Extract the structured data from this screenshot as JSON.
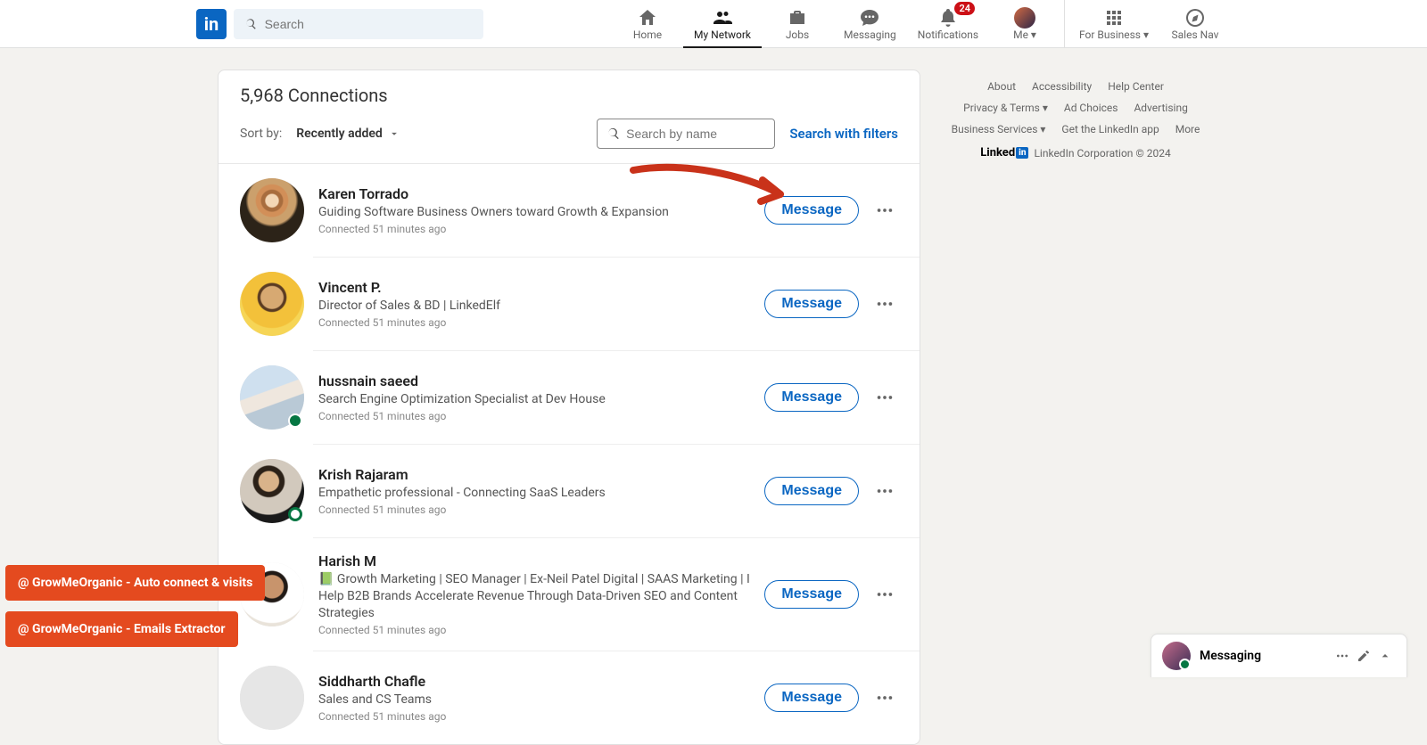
{
  "search": {
    "placeholder": "Search"
  },
  "nav": {
    "home": "Home",
    "network": "My Network",
    "jobs": "Jobs",
    "messaging": "Messaging",
    "notifications": "Notifications",
    "notif_count": "24",
    "me": "Me",
    "business": "For Business",
    "salesnav": "Sales Nav"
  },
  "page": {
    "title": "5,968 Connections",
    "sort_label": "Sort by:",
    "sort_value": "Recently added",
    "name_search_placeholder": "Search by name",
    "filters_link": "Search with filters",
    "message_btn": "Message"
  },
  "connections": [
    {
      "name": "Karen Torrado",
      "headline": "Guiding Software Business Owners toward Growth & Expansion",
      "time": "Connected 51 minutes ago",
      "avatar": "av1",
      "presence": ""
    },
    {
      "name": "Vincent P.",
      "headline": "Director of Sales & BD | LinkedElf",
      "time": "Connected 51 minutes ago",
      "avatar": "av2",
      "presence": ""
    },
    {
      "name": "hussnain saeed",
      "headline": "Search Engine Optimization Specialist at Dev House",
      "time": "Connected 51 minutes ago",
      "avatar": "av3",
      "presence": "green"
    },
    {
      "name": "Krish Rajaram",
      "headline": "Empathetic professional - Connecting SaaS Leaders",
      "time": "Connected 51 minutes ago",
      "avatar": "av4",
      "presence": "ring"
    },
    {
      "name": "Harish M",
      "headline": "📗 Growth Marketing | SEO Manager | Ex-Neil Patel Digital | SAAS Marketing | I Help B2B Brands Accelerate Revenue Through Data-Driven SEO and Content Strategies",
      "time": "Connected 51 minutes ago",
      "avatar": "av5",
      "presence": ""
    },
    {
      "name": "Siddharth Chafle",
      "headline": "Sales and CS Teams",
      "time": "Connected 51 minutes ago",
      "avatar": "av6",
      "presence": ""
    }
  ],
  "footer": {
    "links": [
      "About",
      "Accessibility",
      "Help Center",
      "Privacy & Terms ▾",
      "Ad Choices",
      "Advertising",
      "Business Services ▾",
      "Get the LinkedIn app",
      "More"
    ],
    "copy": "LinkedIn Corporation © 2024"
  },
  "ext": {
    "pill1": "@ GrowMeOrganic - Auto connect & visits",
    "pill2": "@ GrowMeOrganic - Emails Extractor"
  },
  "msgbar": {
    "title": "Messaging"
  }
}
